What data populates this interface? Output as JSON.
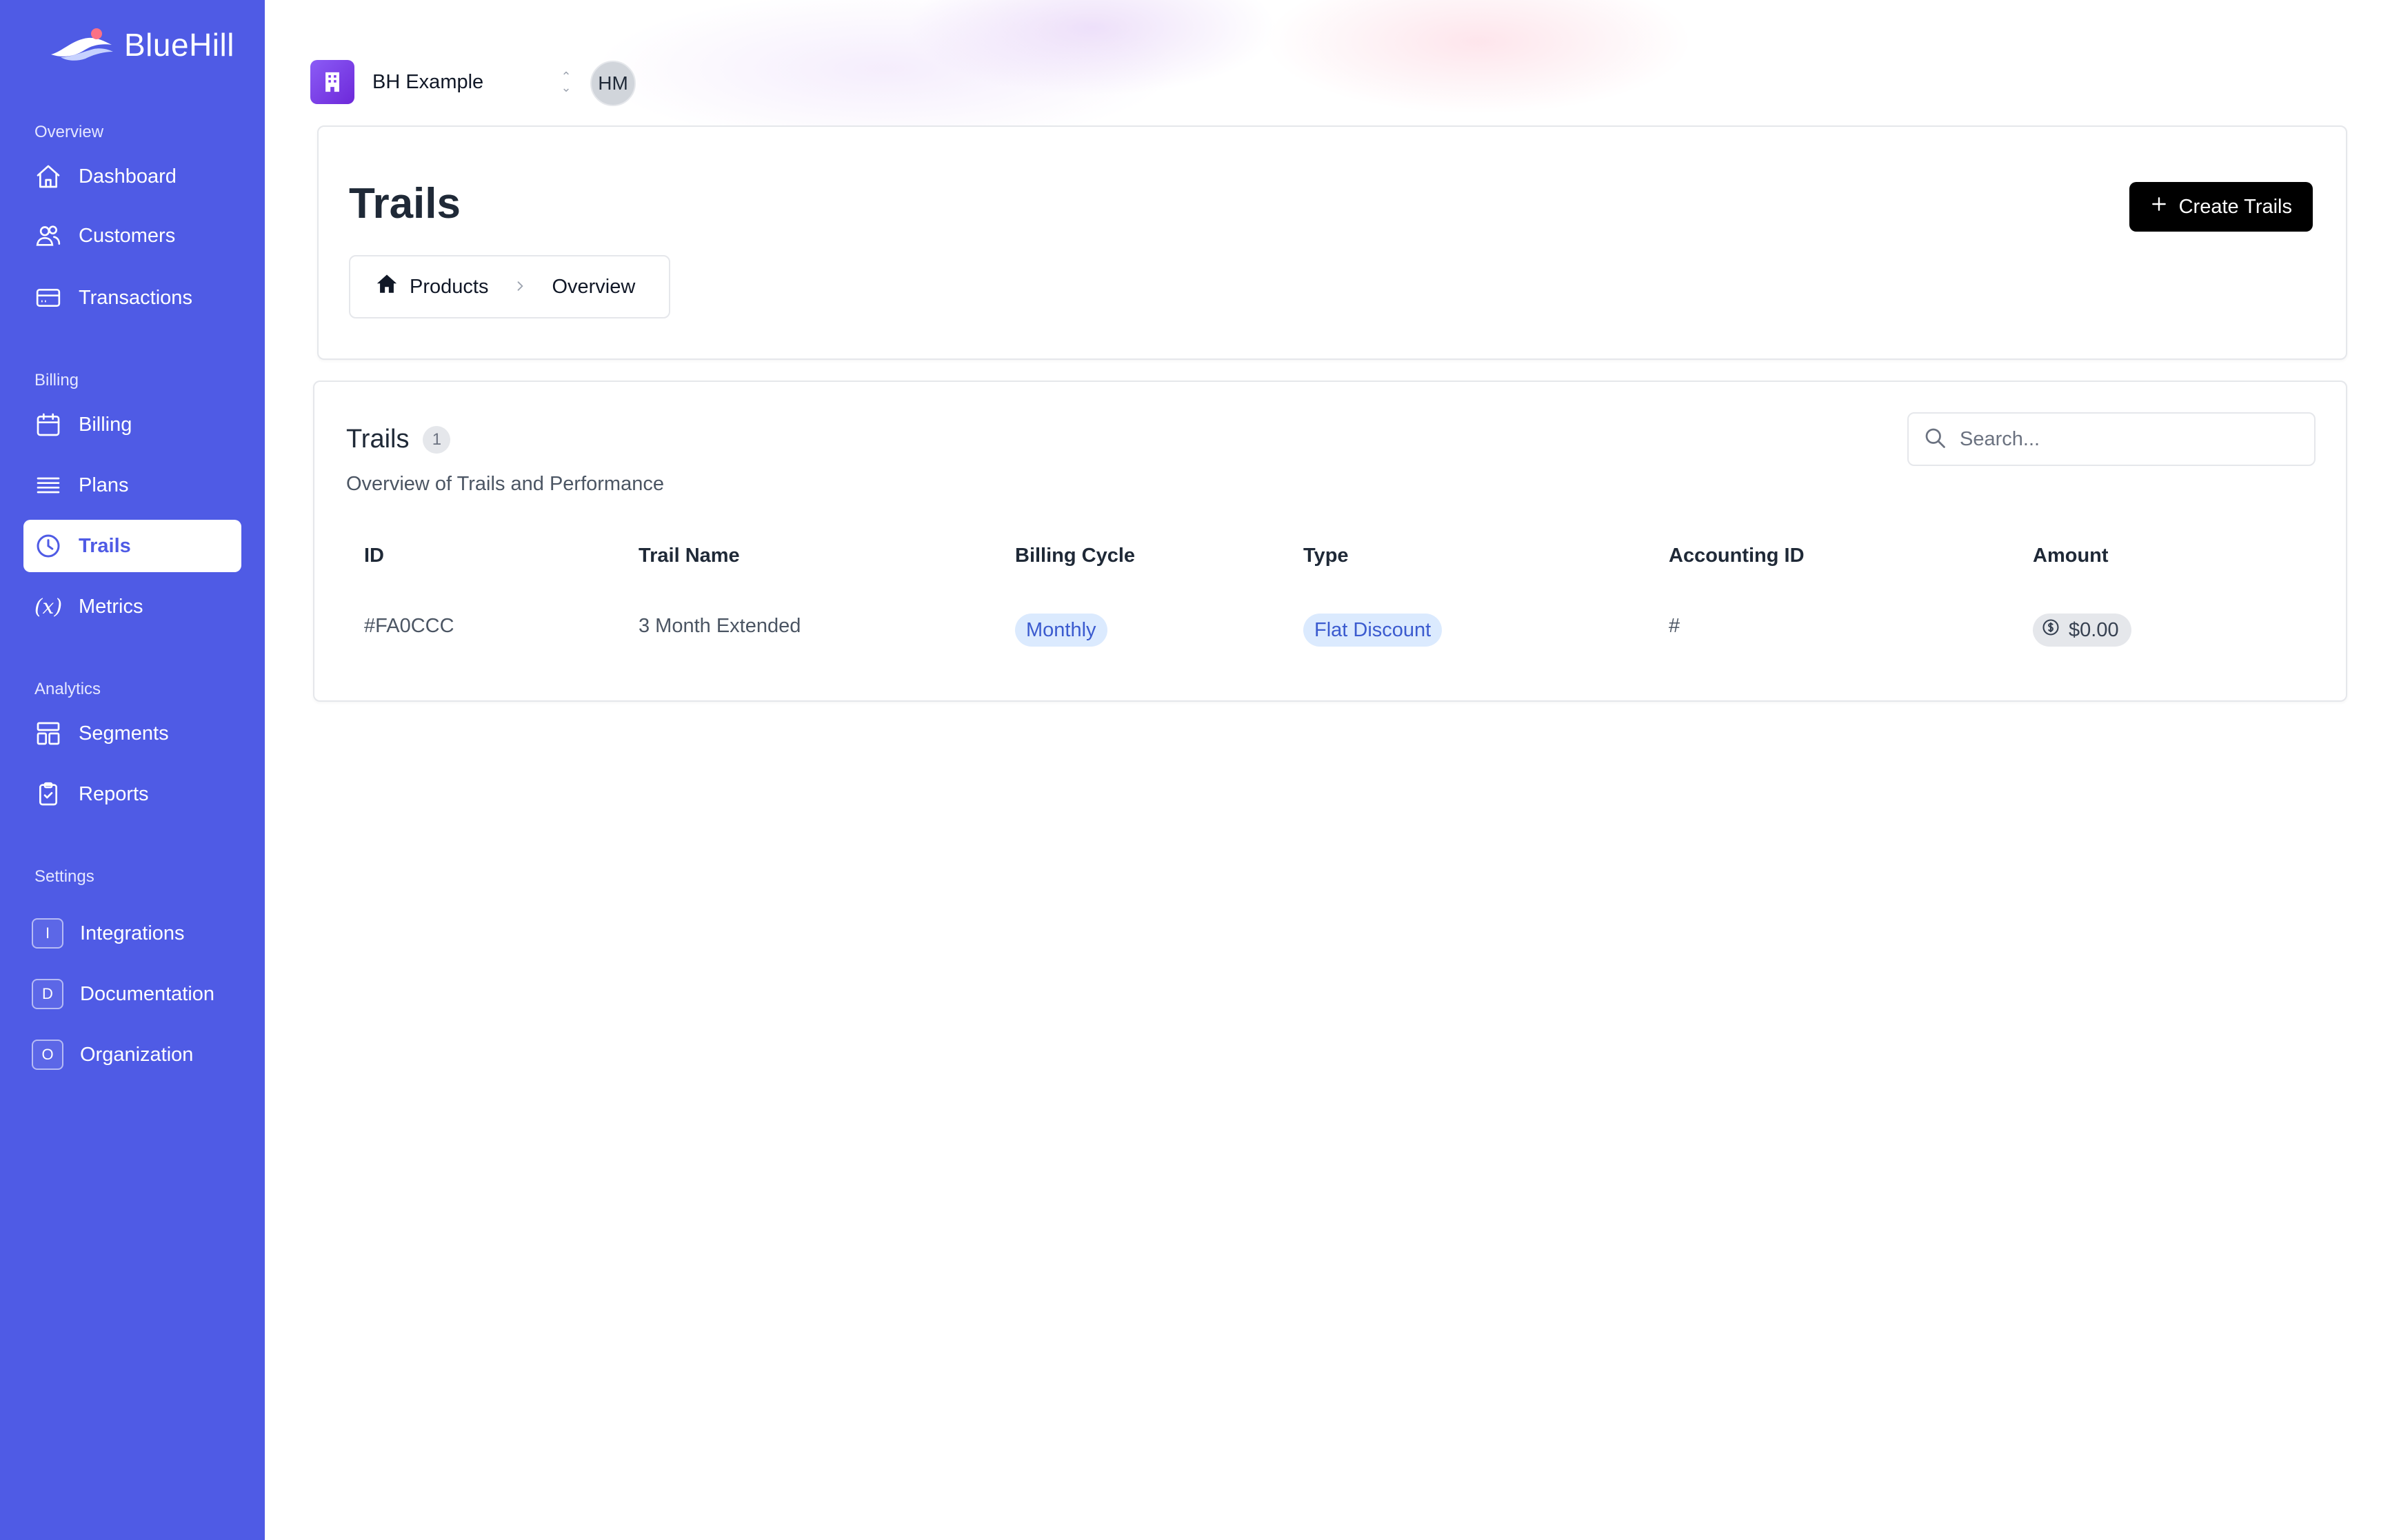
{
  "brand": {
    "name": "BlueHill"
  },
  "sidebar": {
    "sections": [
      {
        "label": "Overview"
      },
      {
        "label": "Billing"
      },
      {
        "label": "Analytics"
      },
      {
        "label": "Settings"
      }
    ],
    "items": [
      {
        "label": "Dashboard",
        "icon": "home-icon"
      },
      {
        "label": "Customers",
        "icon": "users-icon"
      },
      {
        "label": "Transactions",
        "icon": "credit-card-icon"
      },
      {
        "label": "Billing",
        "icon": "calendar-icon"
      },
      {
        "label": "Plans",
        "icon": "list-icon"
      },
      {
        "label": "Trails",
        "icon": "clock-icon",
        "active": true
      },
      {
        "label": "Metrics",
        "icon": "function-icon"
      },
      {
        "label": "Segments",
        "icon": "layout-icon"
      },
      {
        "label": "Reports",
        "icon": "clipboard-icon"
      },
      {
        "label": "Integrations",
        "letter": "I"
      },
      {
        "label": "Documentation",
        "letter": "D"
      },
      {
        "label": "Organization",
        "letter": "O"
      }
    ]
  },
  "topbar": {
    "org_name": "BH Example",
    "avatar_initials": "HM"
  },
  "header": {
    "title": "Trails",
    "create_button": "Create Trails",
    "breadcrumb": [
      "Products",
      "Overview"
    ]
  },
  "table_card": {
    "title": "Trails",
    "count": "1",
    "subtitle": "Overview of Trails and Performance",
    "search_placeholder": "Search...",
    "columns": [
      "ID",
      "Trail Name",
      "Billing Cycle",
      "Type",
      "Accounting ID",
      "Amount"
    ],
    "rows": [
      {
        "id": "#FA0CCC",
        "name": "3 Month Extended",
        "billing_cycle": "Monthly",
        "type": "Flat Discount",
        "accounting_id": "#",
        "amount": "$0.00"
      }
    ]
  },
  "colors": {
    "sidebar_bg": "#4f5be5",
    "accent": "#4f5be5",
    "pill_bg": "#dbeafe",
    "pill_text": "#3b5bcf",
    "button_bg": "#000000"
  }
}
